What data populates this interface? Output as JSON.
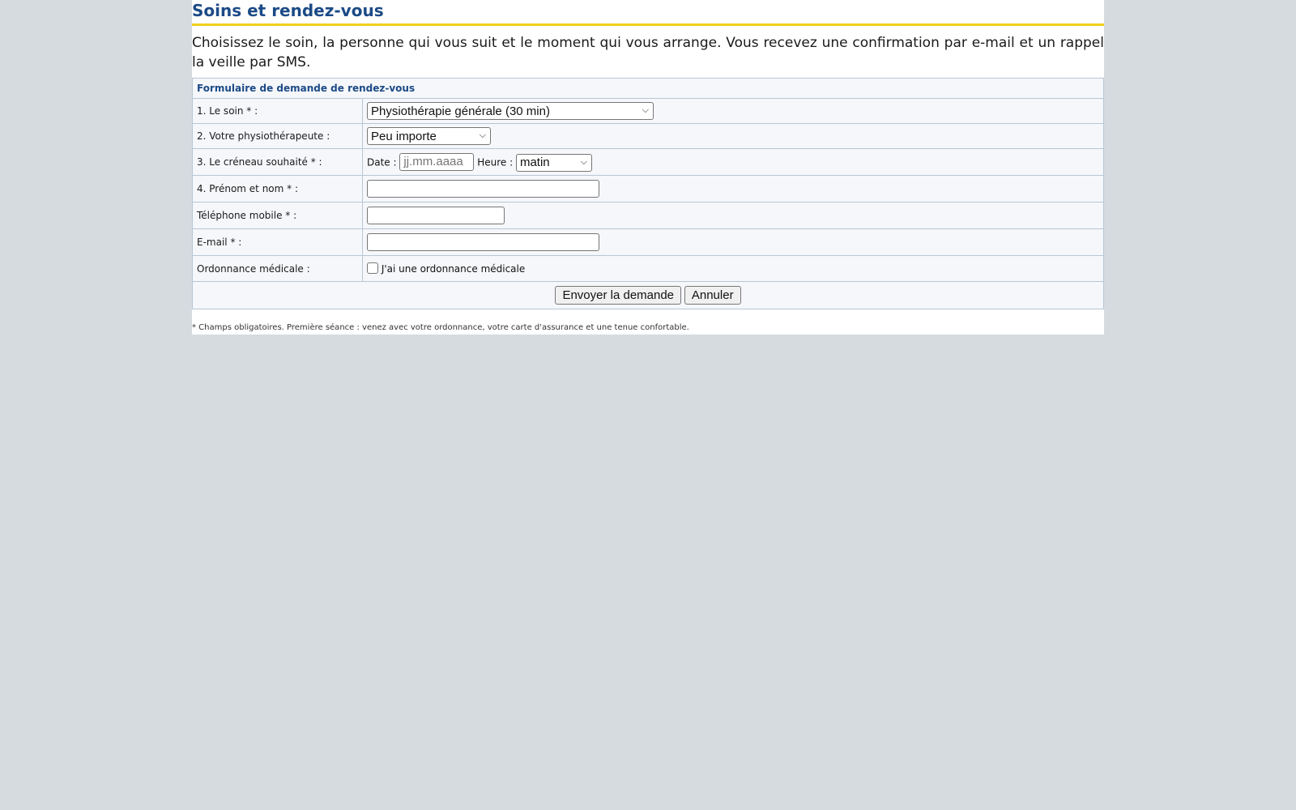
{
  "page": {
    "title": "Soins et rendez-vous",
    "intro": "Choisissez le soin, la personne qui vous suit et le moment qui vous arrange. Vous recevez une confirmation par e-mail et un rappel la veille par SMS."
  },
  "form": {
    "header": "Formulaire de demande de rendez-vous",
    "soin": {
      "label": "1. Le soin * :",
      "value": "Physiothérapie générale (30 min)"
    },
    "physio": {
      "label": "2. Votre physiothérapeute :",
      "value": "Peu importe"
    },
    "creneau": {
      "label": "3. Le créneau souhaité * :",
      "date_label": "Date :",
      "date_placeholder": "jj.mm.aaaa",
      "heure_label": "Heure :",
      "heure_value": "matin"
    },
    "nom": {
      "label": "4. Prénom et nom * :",
      "value": ""
    },
    "telephone": {
      "label": "Téléphone mobile * :",
      "value": ""
    },
    "email": {
      "label": "E-mail * :",
      "value": ""
    },
    "ordonnance": {
      "label": "Ordonnance médicale :",
      "checkbox_label": "J'ai une ordonnance médicale",
      "checked": false
    },
    "submit_label": "Envoyer la demande",
    "cancel_label": "Annuler"
  },
  "footnote": "* Champs obligatoires. Première séance : venez avec votre ordonnance, votre carte d'assurance et une tenue confortable.",
  "colors": {
    "accent": "#1c4a86",
    "rule": "#f2cf1c",
    "header_bg": "#c7d5e6",
    "background": "#d5dbdf"
  },
  "icons": {
    "select_arrow": "chevron-down-icon"
  }
}
